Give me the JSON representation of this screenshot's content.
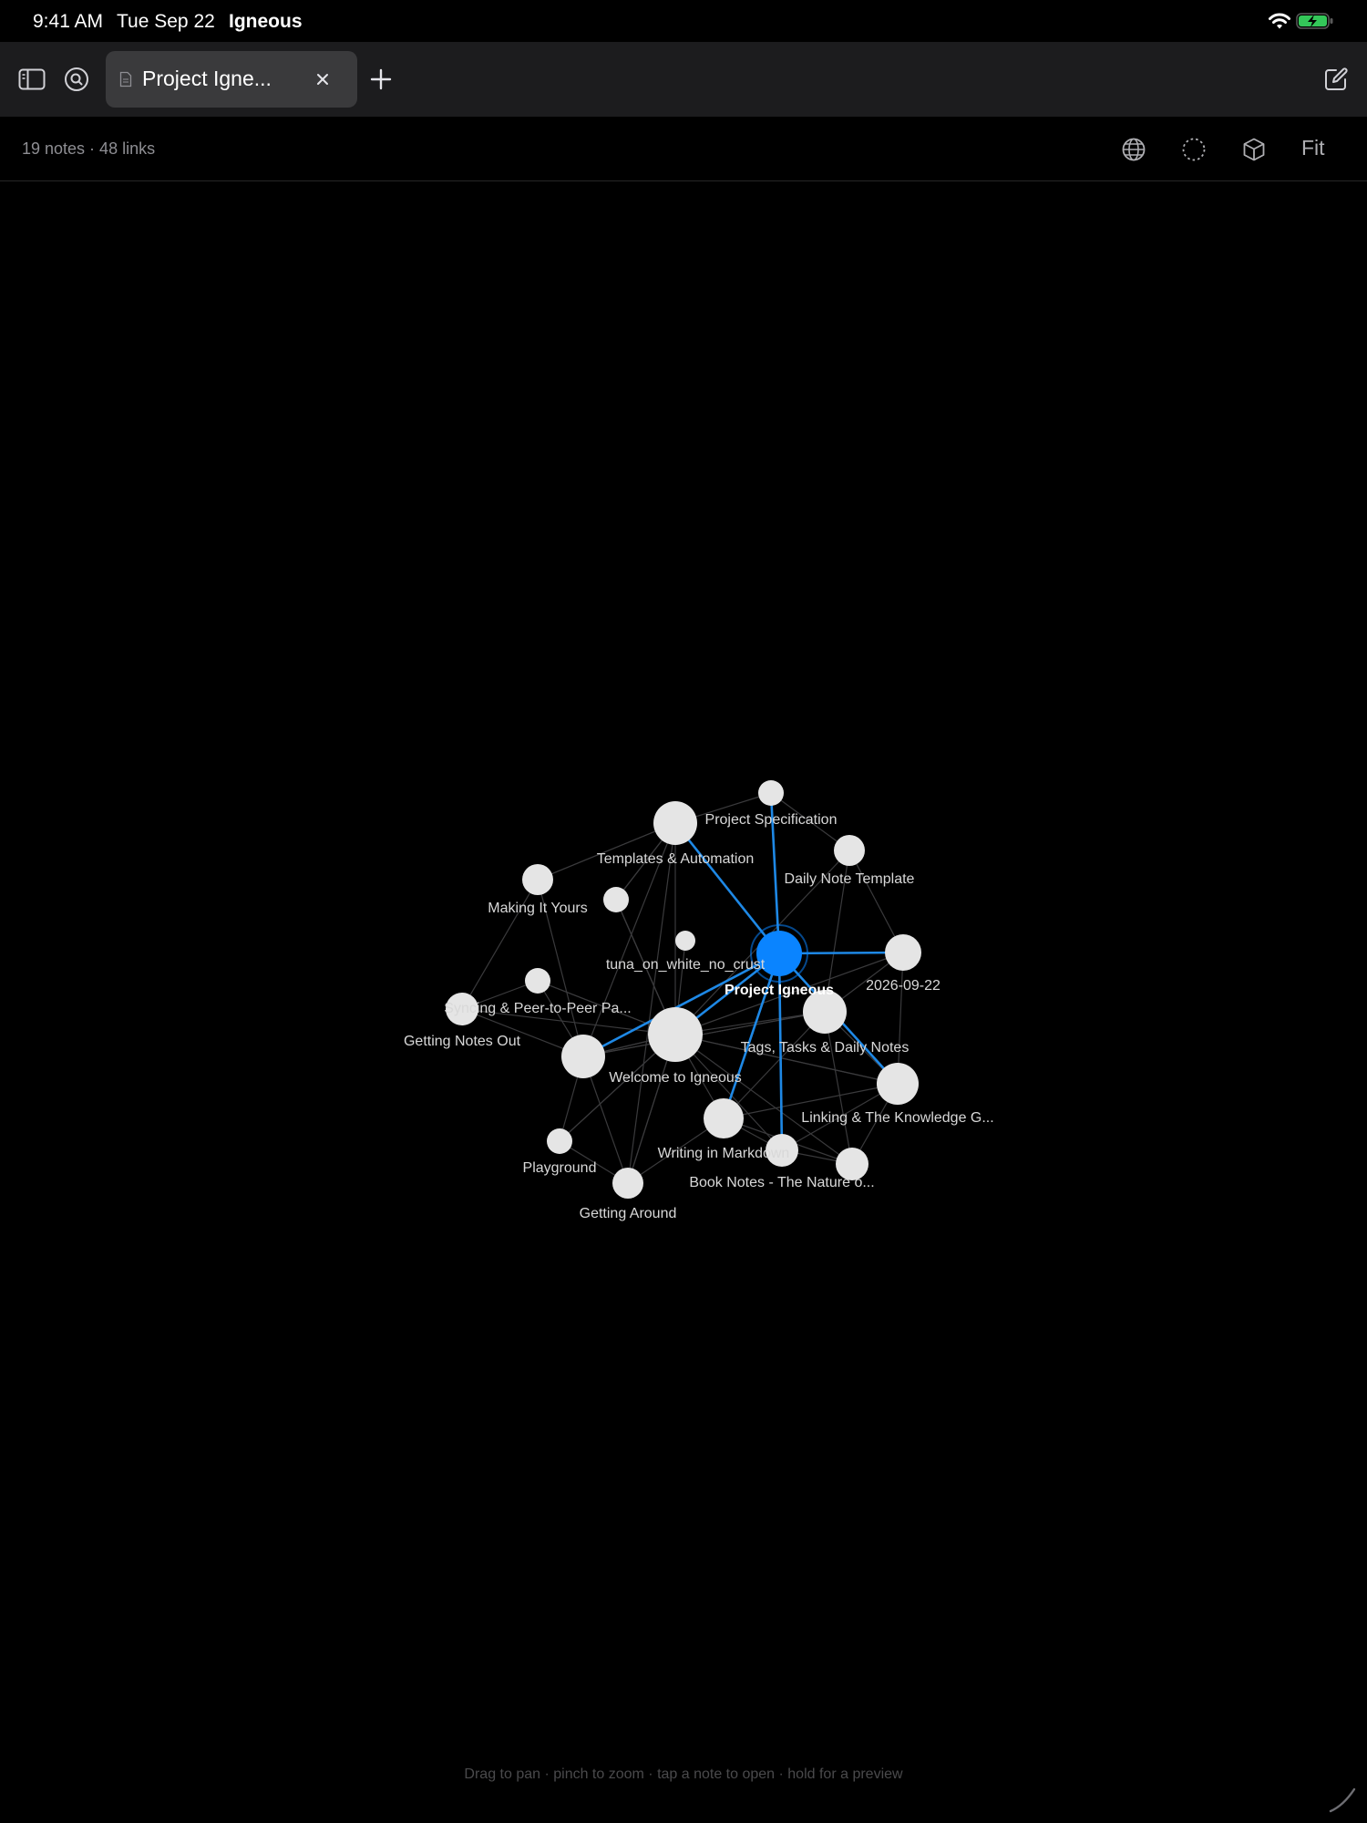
{
  "status_bar": {
    "time": "9:41 AM",
    "date": "Tue Sep 22",
    "app_name": "Igneous"
  },
  "tab_bar": {
    "active_tab_title": "Project Igne...",
    "close_symbol": "×",
    "new_tab_symbol": "+"
  },
  "toolbar": {
    "summary": "19 notes · 48 links",
    "fit_label": "Fit"
  },
  "graph": {
    "focused_note": "Project Igneous",
    "accent_color": "#0a84ff",
    "node_color": "#e5e5e5",
    "notes": [
      {
        "id": "project-igneous",
        "label": "Project Igneous",
        "focused": true
      },
      {
        "id": "project-specification",
        "label": "Project Specification"
      },
      {
        "id": "templates-automation",
        "label": "Templates & Automation"
      },
      {
        "id": "daily-note-template",
        "label": "Daily Note Template"
      },
      {
        "id": "making-it-yours",
        "label": "Making It Yours"
      },
      {
        "id": "tuna",
        "label": "tuna_on_white_no_crust"
      },
      {
        "id": "date-note",
        "label": "2026-09-22"
      },
      {
        "id": "syncing",
        "label": "Syncing & Peer-to-Peer Pa..."
      },
      {
        "id": "getting-notes-out",
        "label": "Getting Notes Out"
      },
      {
        "id": "tags-tasks",
        "label": "Tags, Tasks & Daily Notes"
      },
      {
        "id": "welcome",
        "label": "Welcome to Igneous"
      },
      {
        "id": "linking",
        "label": "Linking & The Knowledge G..."
      },
      {
        "id": "writing-markdown",
        "label": "Writing in Markdown"
      },
      {
        "id": "playground",
        "label": "Playground"
      },
      {
        "id": "book-notes",
        "label": "Book Notes - The Nature o..."
      },
      {
        "id": "getting-around",
        "label": "Getting Around"
      }
    ]
  },
  "hint": "Drag to pan · pinch to zoom · tap a note to open · hold for a preview"
}
